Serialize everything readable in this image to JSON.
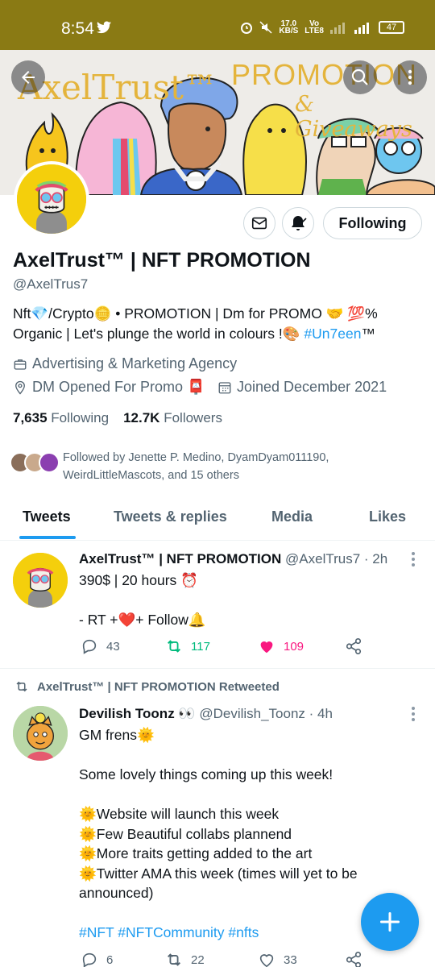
{
  "status_bar": {
    "time": "8:54",
    "speed": "17.0\nKB/S",
    "volte": "Vo\nLTE8",
    "network": "4G",
    "battery": "47"
  },
  "banner": {
    "logo_text": "AxelTrust™",
    "promo_text": "PROMOTION",
    "give_text": "& Giveaways"
  },
  "profile": {
    "following_button": "Following",
    "display_name": "AxelTrust™ | NFT PROMOTION",
    "handle": "@AxelTrus7",
    "bio_part1": "Nft💎/Crypto🪙 • PROMOTION | Dm for PROMO 🤝 💯% Organic | Let's plunge the world in colours !🎨 ",
    "bio_link": "#Un7een",
    "bio_tm": "™",
    "category": "Advertising & Marketing Agency",
    "location": "DM Opened For Promo 📮",
    "joined": "Joined December 2021",
    "following_count": "7,635",
    "following_label": "Following",
    "followers_count": "12.7K",
    "followers_label": "Followers",
    "followed_by": "Followed by Jenette P. Medino, DyamDyam011190, WeirdLittleMascots, and 15 others"
  },
  "tabs": [
    {
      "label": "Tweets"
    },
    {
      "label": "Tweets & replies"
    },
    {
      "label": "Media"
    },
    {
      "label": "Likes"
    }
  ],
  "tweet1": {
    "name": "AxelTrust™ | NFT PROMOTION",
    "meta": "@AxelTrus7 · 2h",
    "line1": "390$ | 20 hours ⏰",
    "line2": "- RT +❤️+ Follow🔔",
    "replies": "43",
    "retweets": "117",
    "likes": "109"
  },
  "retweet_label": "AxelTrust™ | NFT PROMOTION Retweeted",
  "tweet2": {
    "name": "Devilish Toonz 👀",
    "meta": "@Devilish_Toonz · 4h",
    "line1": "GM frens🌞",
    "line2": "Some lovely things coming up this week!",
    "line3": "🌞Website will launch this week",
    "line4": "🌞Few Beautiful collabs plannend",
    "line5": "🌞More traits getting added to the art",
    "line6": "🌞Twitter AMA this week (times will yet to be announced)",
    "hashtags": "#NFT #NFTCommunity #nfts",
    "replies": "6",
    "retweets": "22",
    "likes": "33"
  },
  "colors": {
    "status_bar": "#8a7a14",
    "accent": "#1d9bf0",
    "retweet": "#00ba7c",
    "like": "#f91880",
    "banner_gold": "#e4b43c"
  },
  "icons": [
    "back-arrow-icon",
    "search-icon",
    "more-vertical-icon",
    "mail-icon",
    "bell-icon",
    "briefcase-icon",
    "location-icon",
    "calendar-icon",
    "reply-icon",
    "retweet-icon",
    "heart-icon",
    "share-icon",
    "compose-plus-icon"
  ]
}
